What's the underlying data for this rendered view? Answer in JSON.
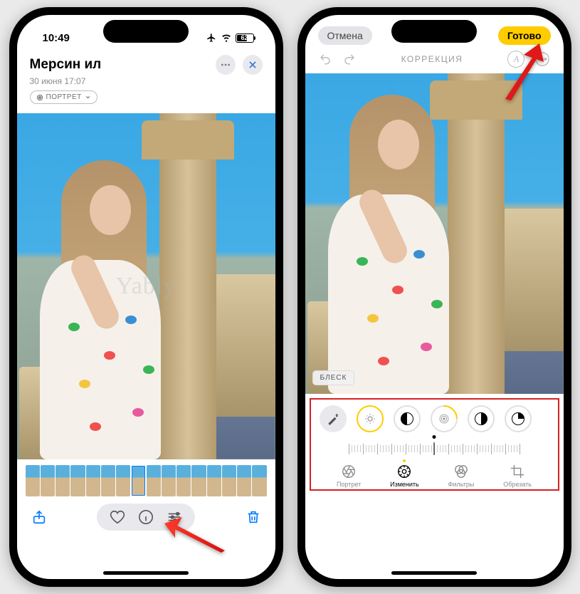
{
  "watermark": "Yably",
  "left": {
    "status": {
      "time": "10:49",
      "battery": "62"
    },
    "title": "Мерсин ил",
    "subtitle": "30 июня 17:07",
    "portrait_chip": "ПОРТРЕТ"
  },
  "right": {
    "cancel": "Отмена",
    "done": "Готово",
    "header": "КОРРЕКЦИЯ",
    "gloss_label": "БЛЕСК",
    "tabs": {
      "portrait": "Портрет",
      "adjust": "Изменить",
      "filters": "Фильтры",
      "crop": "Обрезать"
    }
  }
}
